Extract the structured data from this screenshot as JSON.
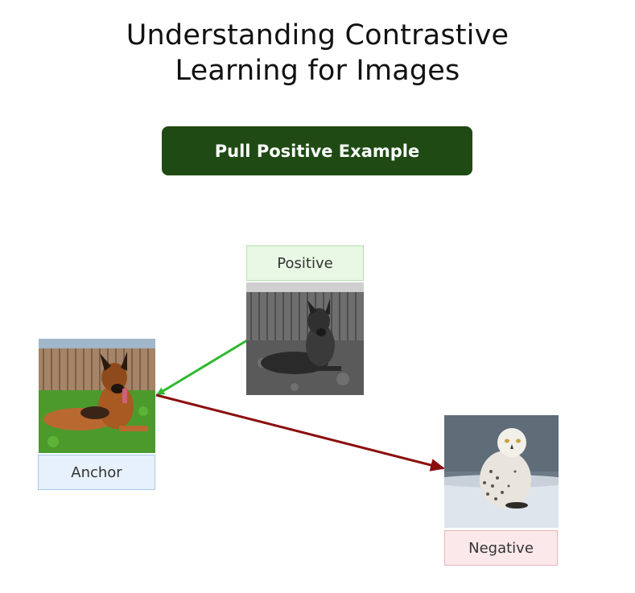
{
  "title": {
    "line1": "Understanding Contrastive",
    "line2": "Learning for Images"
  },
  "action_button": {
    "label": "Pull Positive Example"
  },
  "nodes": {
    "positive": {
      "label": "Positive",
      "image": "grayscale-german-shepherd-photo"
    },
    "anchor": {
      "label": "Anchor",
      "image": "german-shepherd-on-grass-photo"
    },
    "negative": {
      "label": "Negative",
      "image": "snowy-owl-photo"
    }
  },
  "colors": {
    "button_bg": "#1f4a14",
    "positive_arrow": "#2fb82f",
    "negative_arrow": "#8b0f0f",
    "positive_label_bg": "#e8f8e4",
    "positive_label_border": "#b7dfb0",
    "anchor_label_bg": "#e6f1fb",
    "anchor_label_border": "#a9c8e6",
    "negative_label_bg": "#fbe8ea",
    "negative_label_border": "#e4b5bb"
  }
}
